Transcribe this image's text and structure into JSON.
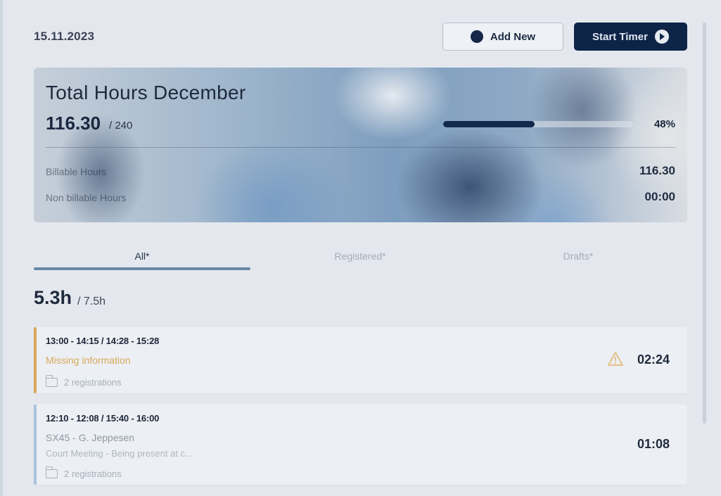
{
  "header": {
    "date": "15.11.2023",
    "add_new_label": "Add New",
    "start_timer_label": "Start Timer"
  },
  "summary": {
    "title": "Total Hours December",
    "hours_value": "116.30",
    "hours_target": "/ 240",
    "progress_percent": 48,
    "progress_label": "48%",
    "rows": [
      {
        "label": "Billable Hours",
        "value": "116.30"
      },
      {
        "label": "Non billable Hours",
        "value": "00:00"
      }
    ]
  },
  "tabs": [
    {
      "label": "All*",
      "active": true
    },
    {
      "label": "Registered*",
      "active": false
    },
    {
      "label": "Drafts*",
      "active": false
    }
  ],
  "day": {
    "total": "5.3h",
    "target": "/ 7.5h"
  },
  "entries": [
    {
      "times": "13:00 - 14:15 / 14:28 - 15:28",
      "line2": "Missing information",
      "line3": "",
      "registrations": "2 registrations",
      "duration": "02:24",
      "warning": true,
      "accent": "#d9a85a"
    },
    {
      "times": "12:10 - 12:08 / 15:40 - 16:00",
      "line2": "SX45 - G. Jeppesen",
      "line3": "Court Meeting - Being present at c...",
      "registrations": "2 registrations",
      "duration": "01:08",
      "warning": false,
      "accent": "#a9c3dd"
    }
  ],
  "colors": {
    "primary": "#0e2447",
    "warning": "#d9a85a",
    "background": "#e4e8ee"
  },
  "icons": {
    "add": "plus-circle-icon",
    "timer": "play-icon",
    "warning": "warning-triangle-icon",
    "folder": "folder-icon"
  }
}
